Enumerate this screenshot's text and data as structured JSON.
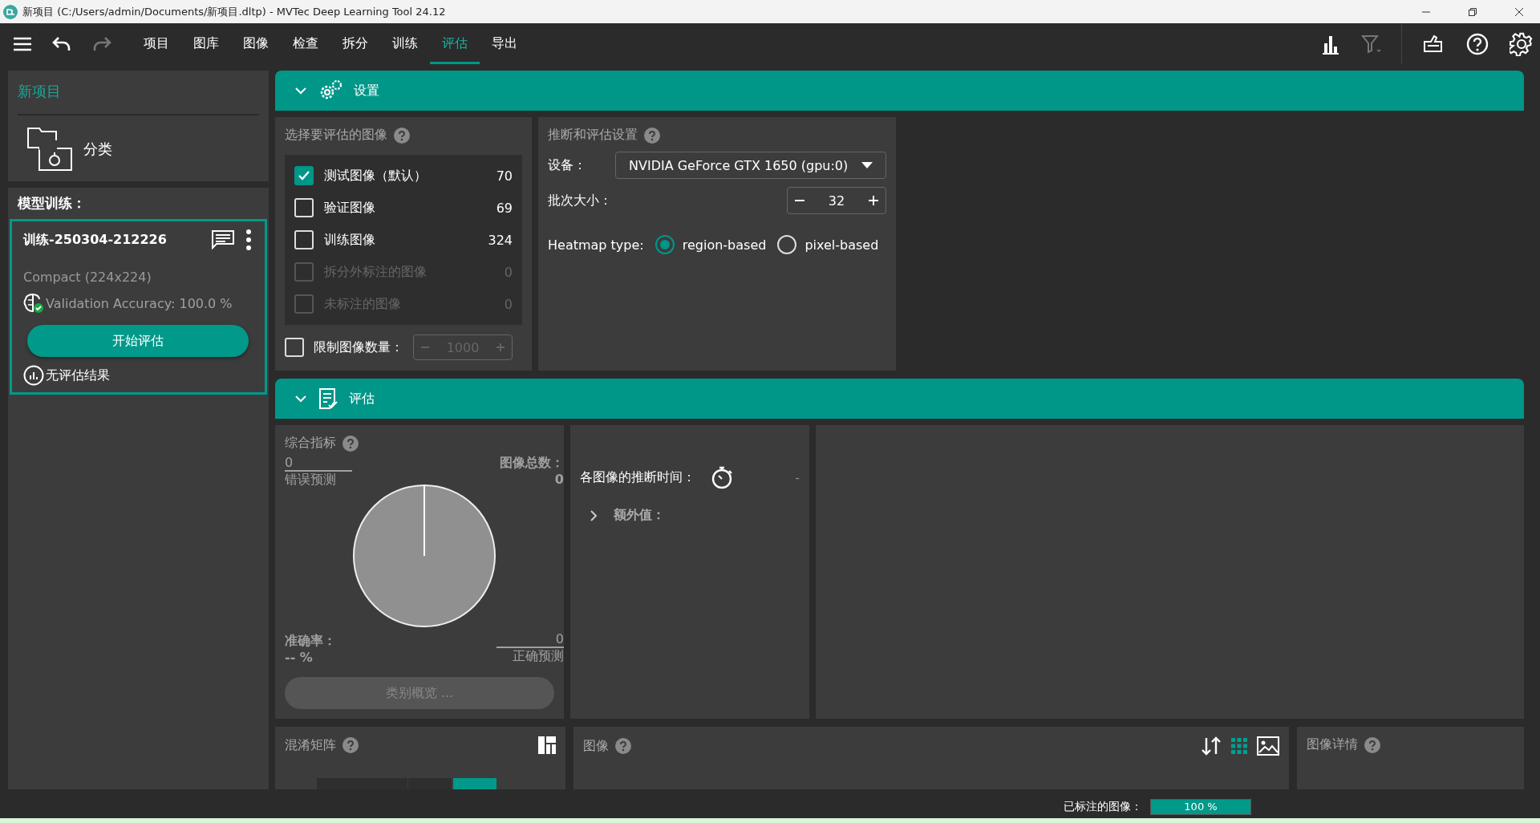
{
  "window": {
    "title": "新项目 (C:/Users/admin/Documents/新项目.dltp) - MVTec Deep Learning Tool 24.12"
  },
  "menu": [
    {
      "label": "项目",
      "selected": false
    },
    {
      "label": "图库",
      "selected": false
    },
    {
      "label": "图像",
      "selected": false
    },
    {
      "label": "检查",
      "selected": false
    },
    {
      "label": "拆分",
      "selected": false
    },
    {
      "label": "训练",
      "selected": false
    },
    {
      "label": "评估",
      "selected": true
    },
    {
      "label": "导出",
      "selected": false
    }
  ],
  "project": {
    "title": "新项目",
    "type": "分类"
  },
  "training": {
    "heading": "模型训练：",
    "run": {
      "name": "训练-250304-212226",
      "model": "Compact (224x224)",
      "accuracy": "Validation Accuracy: 100.0 %",
      "button": "开始评估",
      "result": "无评估结果",
      "selected": true
    }
  },
  "settings": {
    "header": "设置",
    "expanded": true,
    "image_selection": {
      "title": "选择要评估的图像",
      "sets": [
        {
          "label": "测试图像（默认）",
          "count": "70",
          "checked": true,
          "disabled": false
        },
        {
          "label": "验证图像",
          "count": "69",
          "checked": false,
          "disabled": false
        },
        {
          "label": "训练图像",
          "count": "324",
          "checked": false,
          "disabled": false
        },
        {
          "label": "拆分外标注的图像",
          "count": "0",
          "checked": false,
          "disabled": true
        },
        {
          "label": "未标注的图像",
          "count": "0",
          "checked": false,
          "disabled": true
        }
      ],
      "limit": {
        "label": "限制图像数量：",
        "checked": false,
        "value": "1000"
      }
    },
    "inference": {
      "title": "推断和评估设置",
      "device_label": "设备：",
      "device": "NVIDIA GeForce GTX 1650 (gpu:0)",
      "batch_label": "批次大小：",
      "batch": "32",
      "heatmap_label": "Heatmap type:",
      "heatmap_options": [
        {
          "label": "region-based",
          "selected": true
        },
        {
          "label": "pixel-based",
          "selected": false
        }
      ]
    }
  },
  "evaluation": {
    "header": "评估",
    "expanded": true,
    "metrics": {
      "title": "综合指标",
      "wrong_value": "0",
      "wrong_label": "错误预测",
      "total_label": "图像总数：",
      "total_value": "0",
      "correct_value": "0",
      "correct_label": "正确预测",
      "accuracy_label": "准确率：",
      "accuracy_value": "-- %",
      "button": "类别概览 ..."
    },
    "timing": {
      "label": "各图像的推断时间：",
      "value": "-",
      "extra_label": "额外值：",
      "extra_expanded": false
    }
  },
  "bottom": {
    "confusion_title": "混淆矩阵",
    "images_title": "图像",
    "details_title": "图像详情"
  },
  "status_bar": {
    "label": "已标注的图像：",
    "level": 1,
    "reading": "100 %"
  }
}
